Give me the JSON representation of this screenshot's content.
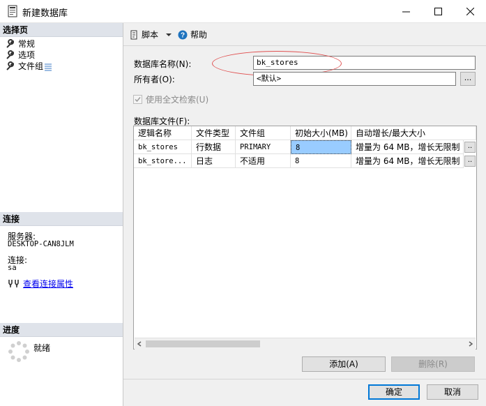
{
  "window": {
    "title": "新建数据库"
  },
  "left": {
    "select_page_header": "选择页",
    "nav_items": [
      {
        "label": "常规",
        "icon": "wrench-icon"
      },
      {
        "label": "选项",
        "icon": "wrench-icon"
      },
      {
        "label": "文件组",
        "icon": "wrench-icon"
      }
    ],
    "connection_header": "连接",
    "server_label": "服务器:",
    "server_value": "DESKTOP-CAN8JLM",
    "connection_label": "连接:",
    "connection_value": "sa",
    "view_conn_props": "查看连接属性",
    "progress_header": "进度",
    "progress_status": "就绪"
  },
  "toolbar": {
    "script_label": "脚本",
    "help_label": "帮助"
  },
  "form": {
    "db_name_label": "数据库名称(N):",
    "db_name_value": "bk_stores",
    "owner_label": "所有者(O):",
    "owner_value": "<默认>",
    "owner_browse": "...",
    "fulltext_label": "使用全文检索(U)",
    "db_files_label": "数据库文件(F):"
  },
  "grid": {
    "headers": [
      "逻辑名称",
      "文件类型",
      "文件组",
      "初始大小(MB)",
      "自动增长/最大大小"
    ],
    "rows": [
      [
        "bk_stores",
        "行数据",
        "PRIMARY",
        "8",
        "增量为 64 MB，增长无限制"
      ],
      [
        "bk_store...",
        "日志",
        "不适用",
        "8",
        "增量为 64 MB，增长无限制"
      ]
    ]
  },
  "buttons": {
    "add": "添加(A)",
    "remove": "删除(R)",
    "ok": "确定",
    "cancel": "取消"
  }
}
